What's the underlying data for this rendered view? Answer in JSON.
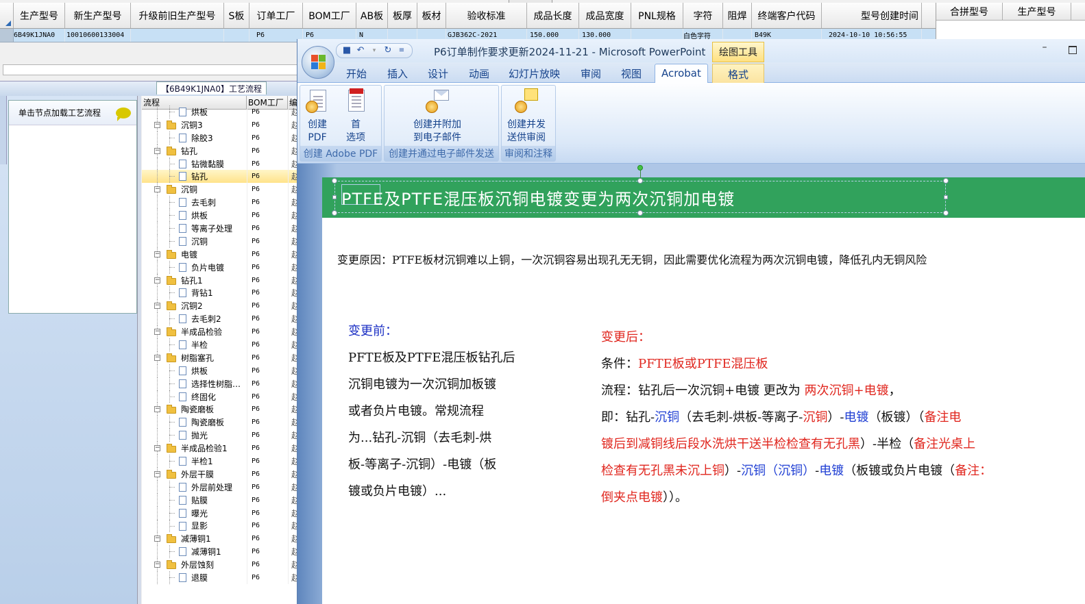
{
  "grid": {
    "headers": [
      "生产型号",
      "新生产型号",
      "升级前旧生产型号",
      "S板",
      "订单工厂",
      "BOM工厂",
      "AB板",
      "板厚",
      "板材",
      "验收标准",
      "成品长度",
      "成品宽度",
      "PNL规格",
      "字符",
      "阻焊",
      "终端客户代码",
      "型号创建时间"
    ],
    "row": [
      "6B49K1JNA0",
      "10010600133004",
      "",
      "",
      "P6",
      "P6",
      "N",
      "",
      "",
      "GJB362C-2021",
      "150.000",
      "130.000",
      "",
      "白色字符",
      "",
      "B49K",
      "2024-10-10 10:56:55"
    ],
    "right_headers": [
      "合拼型号",
      "生产型号"
    ]
  },
  "left_panel": {
    "title": "【6B49K1JNA0】工艺流程",
    "node_hint": "单击节点加载工艺流程",
    "tree_headers": [
      "流程",
      "BOM工厂",
      "编"
    ],
    "tree_rows": [
      {
        "label": "烘板",
        "level": 2,
        "type": "doc",
        "factory": "P6",
        "ed": "赵"
      },
      {
        "label": "沉铜3",
        "level": 1,
        "type": "folder",
        "factory": "P6",
        "ed": "赵"
      },
      {
        "label": "除胶3",
        "level": 2,
        "type": "doc",
        "factory": "P6",
        "ed": "赵"
      },
      {
        "label": "钻孔",
        "level": 1,
        "type": "folder",
        "factory": "P6",
        "ed": "赵"
      },
      {
        "label": "钻微黏膜",
        "level": 2,
        "type": "doc",
        "factory": "P6",
        "ed": "赵"
      },
      {
        "label": "钻孔",
        "level": 2,
        "type": "doc",
        "factory": "P6",
        "ed": "赵",
        "selected": true
      },
      {
        "label": "沉铜",
        "level": 1,
        "type": "folder",
        "factory": "P6",
        "ed": "赵"
      },
      {
        "label": "去毛刺",
        "level": 2,
        "type": "doc",
        "factory": "P6",
        "ed": "赵"
      },
      {
        "label": "烘板",
        "level": 2,
        "type": "doc",
        "factory": "P6",
        "ed": "赵"
      },
      {
        "label": "等离子处理",
        "level": 2,
        "type": "doc",
        "factory": "P6",
        "ed": "赵"
      },
      {
        "label": "沉铜",
        "level": 2,
        "type": "doc",
        "factory": "P6",
        "ed": "赵"
      },
      {
        "label": "电镀",
        "level": 1,
        "type": "folder",
        "factory": "P6",
        "ed": "赵"
      },
      {
        "label": "负片电镀",
        "level": 2,
        "type": "doc",
        "factory": "P6",
        "ed": "赵"
      },
      {
        "label": "钻孔1",
        "level": 1,
        "type": "folder",
        "factory": "P6",
        "ed": "赵"
      },
      {
        "label": "背钻1",
        "level": 2,
        "type": "doc",
        "factory": "P6",
        "ed": "赵"
      },
      {
        "label": "沉铜2",
        "level": 1,
        "type": "folder",
        "factory": "P6",
        "ed": "赵"
      },
      {
        "label": "去毛刺2",
        "level": 2,
        "type": "doc",
        "factory": "P6",
        "ed": "赵"
      },
      {
        "label": "半成品检验",
        "level": 1,
        "type": "folder",
        "factory": "P6",
        "ed": "赵"
      },
      {
        "label": "半检",
        "level": 2,
        "type": "doc",
        "factory": "P6",
        "ed": "赵"
      },
      {
        "label": "树脂塞孔",
        "level": 1,
        "type": "folder",
        "factory": "P6",
        "ed": "赵"
      },
      {
        "label": "烘板",
        "level": 2,
        "type": "doc",
        "factory": "P6",
        "ed": "赵"
      },
      {
        "label": "选择性树脂…",
        "level": 2,
        "type": "doc",
        "factory": "P6",
        "ed": "赵"
      },
      {
        "label": "终固化",
        "level": 2,
        "type": "doc",
        "factory": "P6",
        "ed": "赵"
      },
      {
        "label": "陶瓷磨板",
        "level": 1,
        "type": "folder",
        "factory": "P6",
        "ed": "赵"
      },
      {
        "label": "陶瓷磨板",
        "level": 2,
        "type": "doc",
        "factory": "P6",
        "ed": "赵"
      },
      {
        "label": "抛光",
        "level": 2,
        "type": "doc",
        "factory": "P6",
        "ed": "赵"
      },
      {
        "label": "半成品检验1",
        "level": 1,
        "type": "folder",
        "factory": "P6",
        "ed": "赵"
      },
      {
        "label": "半检1",
        "level": 2,
        "type": "doc",
        "factory": "P6",
        "ed": "赵"
      },
      {
        "label": "外层干膜",
        "level": 1,
        "type": "folder",
        "factory": "P6",
        "ed": "赵"
      },
      {
        "label": "外层前处理",
        "level": 2,
        "type": "doc",
        "factory": "P6",
        "ed": "赵"
      },
      {
        "label": "贴膜",
        "level": 2,
        "type": "doc",
        "factory": "P6",
        "ed": "赵"
      },
      {
        "label": "曝光",
        "level": 2,
        "type": "doc",
        "factory": "P6",
        "ed": "赵"
      },
      {
        "label": "显影",
        "level": 2,
        "type": "doc",
        "factory": "P6",
        "ed": "赵"
      },
      {
        "label": "减薄铜1",
        "level": 1,
        "type": "folder",
        "factory": "P6",
        "ed": "赵"
      },
      {
        "label": "减薄铜1",
        "level": 2,
        "type": "doc",
        "factory": "P6",
        "ed": "赵"
      },
      {
        "label": "外层蚀刻",
        "level": 1,
        "type": "folder",
        "factory": "P6",
        "ed": "赵"
      },
      {
        "label": "退膜",
        "level": 2,
        "type": "doc",
        "factory": "P6",
        "ed": "赵"
      }
    ]
  },
  "ppt": {
    "window_title": "P6订单制作要求更新2024-11-21 - Microsoft PowerPoint",
    "context_title": "绘图工具",
    "tabs": [
      "开始",
      "插入",
      "设计",
      "动画",
      "幻灯片放映",
      "审阅",
      "视图",
      "Acrobat",
      "格式"
    ],
    "active_tab": "Acrobat",
    "ribbon": {
      "groups": [
        "创建 Adobe PDF",
        "创建并通过电子邮件发送",
        "审阅和注释"
      ],
      "btn_create_pdf": [
        "创建",
        "PDF"
      ],
      "btn_prefs": [
        "首",
        "选项"
      ],
      "btn_email": [
        "创建并附加",
        "到电子邮件"
      ],
      "btn_review": [
        "创建并发",
        "送供审阅"
      ]
    },
    "slide": {
      "title": "PTFE及PTFE混压板沉铜电镀变更为两次沉铜加电镀",
      "reason": "变更原因：PTFE板材沉铜难以上铜，一次沉铜容易出现孔无无铜，因此需要优化流程为两次沉铜电镀，降低孔内无铜风险",
      "before_title": "变更前：",
      "before_lines": [
        "PFTE板及PTFE混压板钻孔后",
        "沉铜电镀为一次沉铜加板镀",
        "或者负片电镀。常规流程",
        "为...钻孔-沉铜（去毛刺-烘",
        "板-等离子-沉铜）-电镀（板",
        "镀或负片电镀）..."
      ],
      "after_title": "变更后：",
      "cond_label": "条件：",
      "cond_value": "PFTE板或PTFE混压板",
      "flow_label": "流程：钻孔后一次沉铜+电镀 更改为 ",
      "flow_value": "两次沉铜+电镀",
      "flow_end": "，",
      "ji": "即：钻孔-",
      "cu1": "沉铜",
      "p1": "（去毛刺-烘板-等离子-",
      "cu2": "沉铜",
      "p2": "）-",
      "ele1": "电镀",
      "p3": "（板镀）（",
      "note1a": "备注电",
      "note1b": "镀后到减铜线后段水洗烘干送半检检查有无孔黑",
      "p4": "）-半检（",
      "note2a": "备注光桌上",
      "note2b": "检查有无孔黑未沉上铜",
      "p5": "）-",
      "cu3": "沉铜（沉铜）",
      "p6": "-",
      "ele2": "电镀",
      "p7": "（板镀或负片电镀（",
      "note3a": "备注：",
      "note3b": "倒夹点电镀",
      "p8": "））。"
    }
  }
}
